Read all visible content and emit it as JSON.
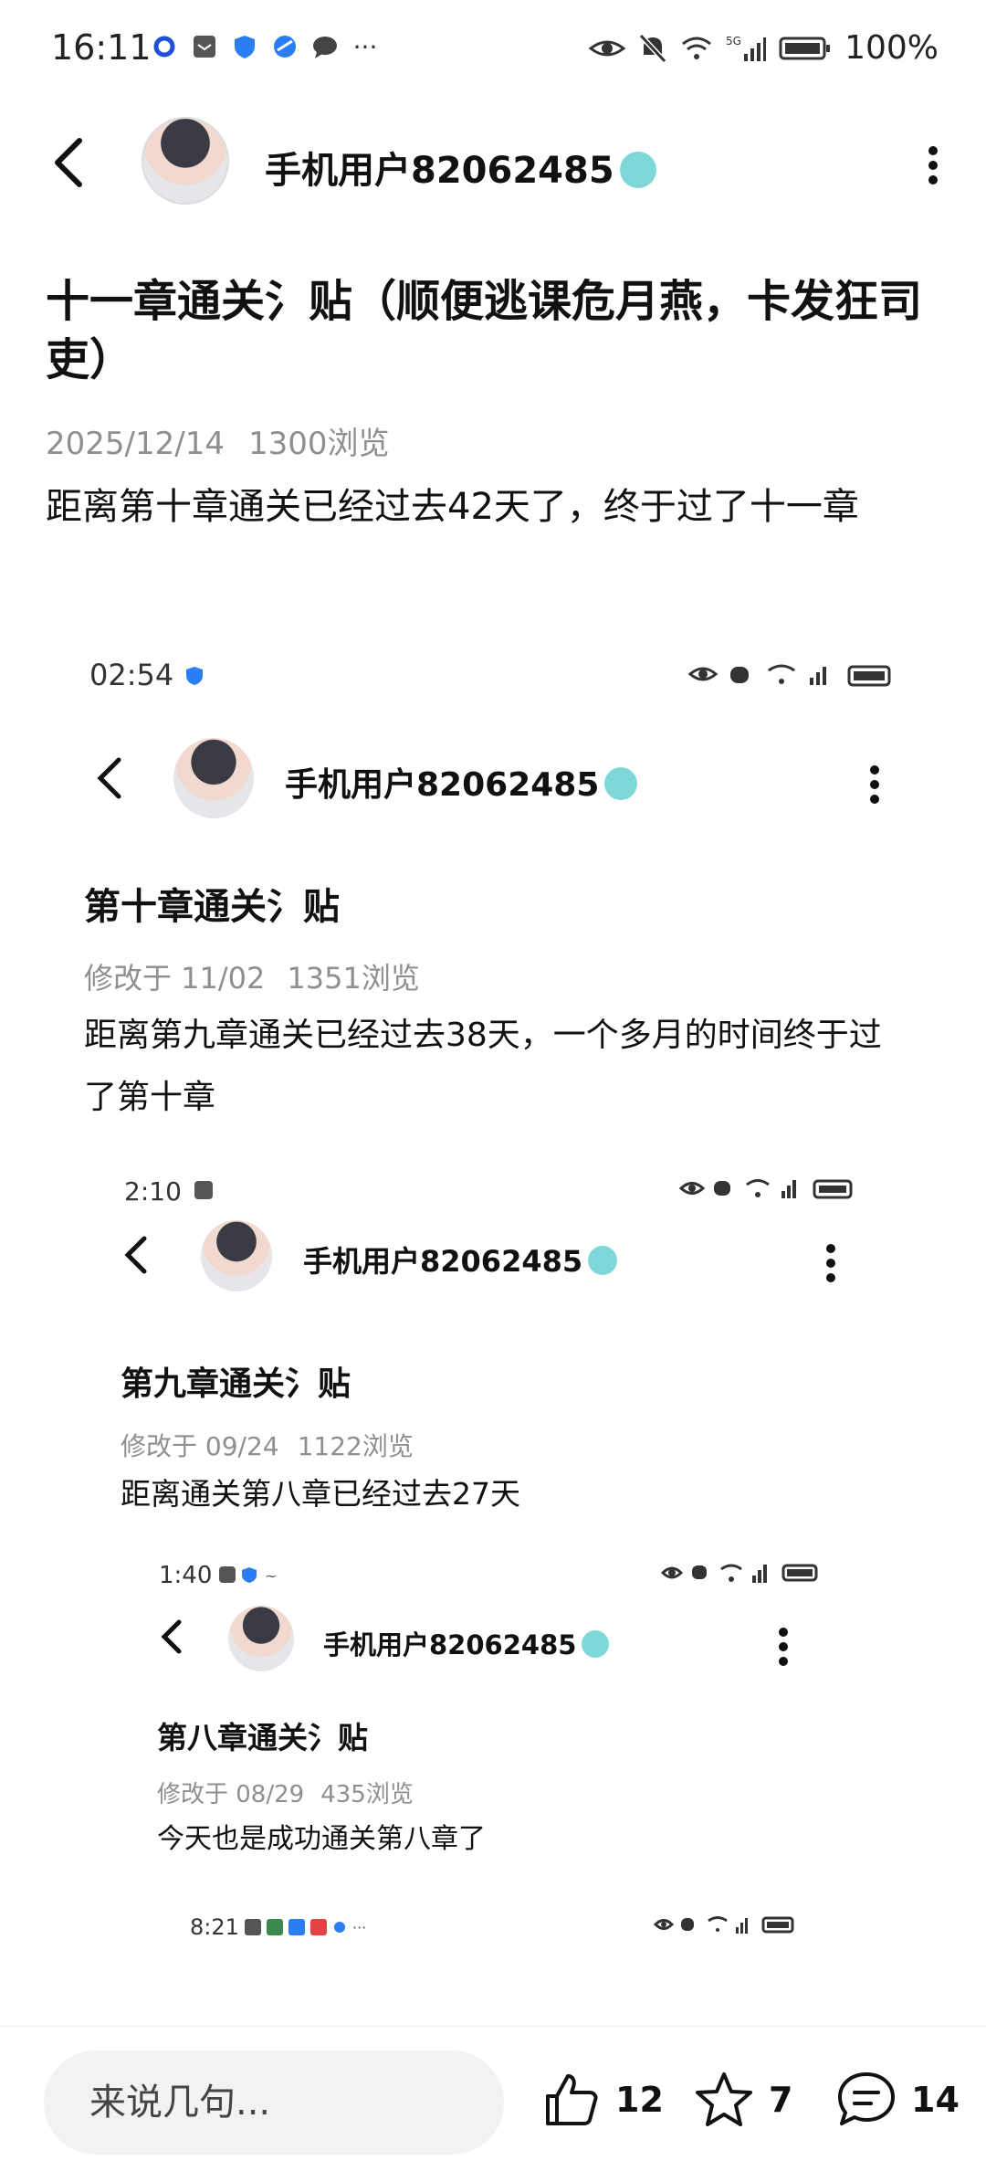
{
  "status_bar": {
    "time": "16:11",
    "battery": "100%",
    "ellipsis": "···"
  },
  "header": {
    "username": "手机用户82062485"
  },
  "post": {
    "title": "十一章通关氵贴（顺便逃课危月燕，卡发狂司吏）",
    "date": "2025/12/14",
    "views": "1300浏览",
    "body": "距离第十章通关已经过去42天了，终于过了十一章"
  },
  "nested": [
    {
      "time": "02:54",
      "username": "手机用户82062485",
      "title": "第十章通关氵贴",
      "modified": "修改于 11/02",
      "views": "1351浏览",
      "text": "距离第九章通关已经过去38天，一个多月的时间终于过了第十章"
    },
    {
      "time": "2:10",
      "username": "手机用户82062485",
      "title": "第九章通关氵贴",
      "modified": "修改于 09/24",
      "views": "1122浏览",
      "text": "距离通关第八章已经过去27天"
    },
    {
      "time": "1:40",
      "username": "手机用户82062485",
      "title": "第八章通关氵贴",
      "modified": "修改于 08/29",
      "views": "435浏览",
      "text": "今天也是成功通关第八章了"
    },
    {
      "time": "8:21"
    }
  ],
  "bottom_bar": {
    "input_placeholder": "来说几句...",
    "likes": "12",
    "favorites": "7",
    "comments": "14"
  }
}
